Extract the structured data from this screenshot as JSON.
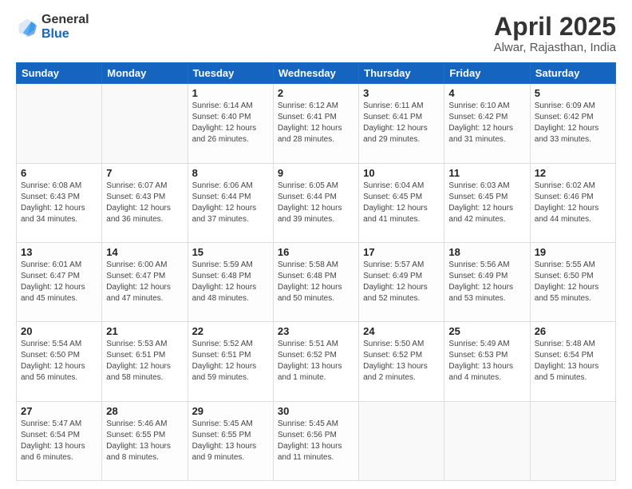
{
  "logo": {
    "general": "General",
    "blue": "Blue"
  },
  "header": {
    "month": "April 2025",
    "location": "Alwar, Rajasthan, India"
  },
  "weekdays": [
    "Sunday",
    "Monday",
    "Tuesday",
    "Wednesday",
    "Thursday",
    "Friday",
    "Saturday"
  ],
  "weeks": [
    [
      {
        "day": "",
        "info": ""
      },
      {
        "day": "",
        "info": ""
      },
      {
        "day": "1",
        "info": "Sunrise: 6:14 AM\nSunset: 6:40 PM\nDaylight: 12 hours\nand 26 minutes."
      },
      {
        "day": "2",
        "info": "Sunrise: 6:12 AM\nSunset: 6:41 PM\nDaylight: 12 hours\nand 28 minutes."
      },
      {
        "day": "3",
        "info": "Sunrise: 6:11 AM\nSunset: 6:41 PM\nDaylight: 12 hours\nand 29 minutes."
      },
      {
        "day": "4",
        "info": "Sunrise: 6:10 AM\nSunset: 6:42 PM\nDaylight: 12 hours\nand 31 minutes."
      },
      {
        "day": "5",
        "info": "Sunrise: 6:09 AM\nSunset: 6:42 PM\nDaylight: 12 hours\nand 33 minutes."
      }
    ],
    [
      {
        "day": "6",
        "info": "Sunrise: 6:08 AM\nSunset: 6:43 PM\nDaylight: 12 hours\nand 34 minutes."
      },
      {
        "day": "7",
        "info": "Sunrise: 6:07 AM\nSunset: 6:43 PM\nDaylight: 12 hours\nand 36 minutes."
      },
      {
        "day": "8",
        "info": "Sunrise: 6:06 AM\nSunset: 6:44 PM\nDaylight: 12 hours\nand 37 minutes."
      },
      {
        "day": "9",
        "info": "Sunrise: 6:05 AM\nSunset: 6:44 PM\nDaylight: 12 hours\nand 39 minutes."
      },
      {
        "day": "10",
        "info": "Sunrise: 6:04 AM\nSunset: 6:45 PM\nDaylight: 12 hours\nand 41 minutes."
      },
      {
        "day": "11",
        "info": "Sunrise: 6:03 AM\nSunset: 6:45 PM\nDaylight: 12 hours\nand 42 minutes."
      },
      {
        "day": "12",
        "info": "Sunrise: 6:02 AM\nSunset: 6:46 PM\nDaylight: 12 hours\nand 44 minutes."
      }
    ],
    [
      {
        "day": "13",
        "info": "Sunrise: 6:01 AM\nSunset: 6:47 PM\nDaylight: 12 hours\nand 45 minutes."
      },
      {
        "day": "14",
        "info": "Sunrise: 6:00 AM\nSunset: 6:47 PM\nDaylight: 12 hours\nand 47 minutes."
      },
      {
        "day": "15",
        "info": "Sunrise: 5:59 AM\nSunset: 6:48 PM\nDaylight: 12 hours\nand 48 minutes."
      },
      {
        "day": "16",
        "info": "Sunrise: 5:58 AM\nSunset: 6:48 PM\nDaylight: 12 hours\nand 50 minutes."
      },
      {
        "day": "17",
        "info": "Sunrise: 5:57 AM\nSunset: 6:49 PM\nDaylight: 12 hours\nand 52 minutes."
      },
      {
        "day": "18",
        "info": "Sunrise: 5:56 AM\nSunset: 6:49 PM\nDaylight: 12 hours\nand 53 minutes."
      },
      {
        "day": "19",
        "info": "Sunrise: 5:55 AM\nSunset: 6:50 PM\nDaylight: 12 hours\nand 55 minutes."
      }
    ],
    [
      {
        "day": "20",
        "info": "Sunrise: 5:54 AM\nSunset: 6:50 PM\nDaylight: 12 hours\nand 56 minutes."
      },
      {
        "day": "21",
        "info": "Sunrise: 5:53 AM\nSunset: 6:51 PM\nDaylight: 12 hours\nand 58 minutes."
      },
      {
        "day": "22",
        "info": "Sunrise: 5:52 AM\nSunset: 6:51 PM\nDaylight: 12 hours\nand 59 minutes."
      },
      {
        "day": "23",
        "info": "Sunrise: 5:51 AM\nSunset: 6:52 PM\nDaylight: 13 hours\nand 1 minute."
      },
      {
        "day": "24",
        "info": "Sunrise: 5:50 AM\nSunset: 6:52 PM\nDaylight: 13 hours\nand 2 minutes."
      },
      {
        "day": "25",
        "info": "Sunrise: 5:49 AM\nSunset: 6:53 PM\nDaylight: 13 hours\nand 4 minutes."
      },
      {
        "day": "26",
        "info": "Sunrise: 5:48 AM\nSunset: 6:54 PM\nDaylight: 13 hours\nand 5 minutes."
      }
    ],
    [
      {
        "day": "27",
        "info": "Sunrise: 5:47 AM\nSunset: 6:54 PM\nDaylight: 13 hours\nand 6 minutes."
      },
      {
        "day": "28",
        "info": "Sunrise: 5:46 AM\nSunset: 6:55 PM\nDaylight: 13 hours\nand 8 minutes."
      },
      {
        "day": "29",
        "info": "Sunrise: 5:45 AM\nSunset: 6:55 PM\nDaylight: 13 hours\nand 9 minutes."
      },
      {
        "day": "30",
        "info": "Sunrise: 5:45 AM\nSunset: 6:56 PM\nDaylight: 13 hours\nand 11 minutes."
      },
      {
        "day": "",
        "info": ""
      },
      {
        "day": "",
        "info": ""
      },
      {
        "day": "",
        "info": ""
      }
    ]
  ]
}
